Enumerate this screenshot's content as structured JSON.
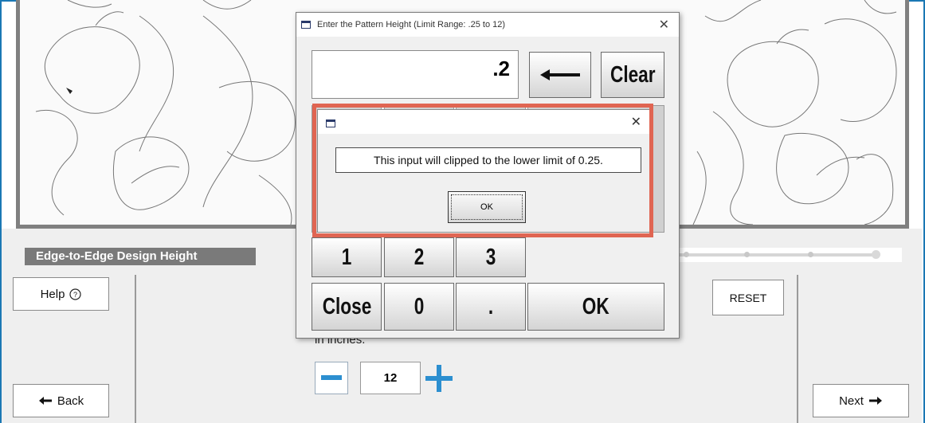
{
  "design_height_label": "Edge-to-Edge Design Height",
  "buttons": {
    "help": "Help",
    "reset": "RESET",
    "back": "Back",
    "next": "Next"
  },
  "inches_text": "in inches.",
  "stepper": {
    "value": "12"
  },
  "keypad_dialog": {
    "title": "Enter the Pattern Height   (Limit Range: .25 to 12)",
    "display_value": ".2",
    "keys": {
      "clear": "Clear",
      "one": "1",
      "two": "2",
      "three": "3",
      "close": "Close",
      "zero": "0",
      "dot": ".",
      "ok": "OK"
    }
  },
  "message_box": {
    "text": "This input will clipped to the lower limit of 0.25.",
    "ok": "OK"
  },
  "colors": {
    "frame_blue": "#1b78b4",
    "highlight": "#e06552",
    "stepper_blue": "#2c8fd0"
  },
  "icons": [
    "help-circle-icon",
    "arrow-left-icon",
    "arrow-right-icon",
    "minus-icon",
    "plus-icon",
    "backspace-arrow-icon",
    "window-icon",
    "close-icon",
    "cursor-icon"
  ]
}
